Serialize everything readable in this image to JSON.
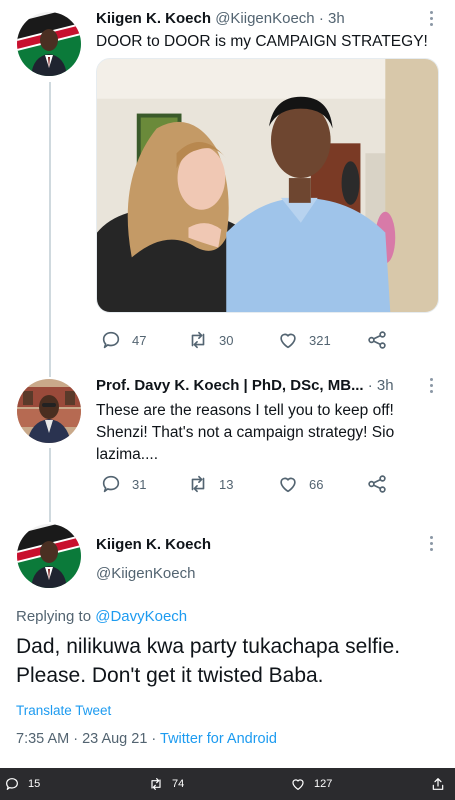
{
  "tweet1": {
    "name": "Kiigen K. Koech",
    "handle": "@KiigenKoech",
    "time": "· 3h",
    "text": "DOOR to DOOR is my CAMPAIGN STRATEGY!",
    "replies": "47",
    "retweets": "30",
    "likes": "321"
  },
  "tweet2": {
    "name": "Prof. Davy K. Koech | PhD, DSc, MB...",
    "time": "· 3h",
    "text": "These are the reasons I tell you to keep off! Shenzi! That's not a campaign strategy! Sio lazima....",
    "replies": "31",
    "retweets": "13",
    "likes": "66"
  },
  "tweet3": {
    "name": "Kiigen K. Koech",
    "handle": "@KiigenKoech",
    "replying_label": "Replying to",
    "replying_handle": "@DavyKoech",
    "text": "Dad, nilikuwa kwa party tukachapa selfie. Please. Don't get it twisted Baba.",
    "translate": "Translate Tweet",
    "timestamp": "7:35 AM · 23 Aug 21 · ",
    "client": "Twitter for Android"
  },
  "bottom_bar": {
    "replies": "15",
    "retweets": "74",
    "likes": "127"
  },
  "colors": {
    "accent": "#1d9bf0",
    "secondary_text": "#536471",
    "bottom_bar": "#2b2b2e"
  }
}
